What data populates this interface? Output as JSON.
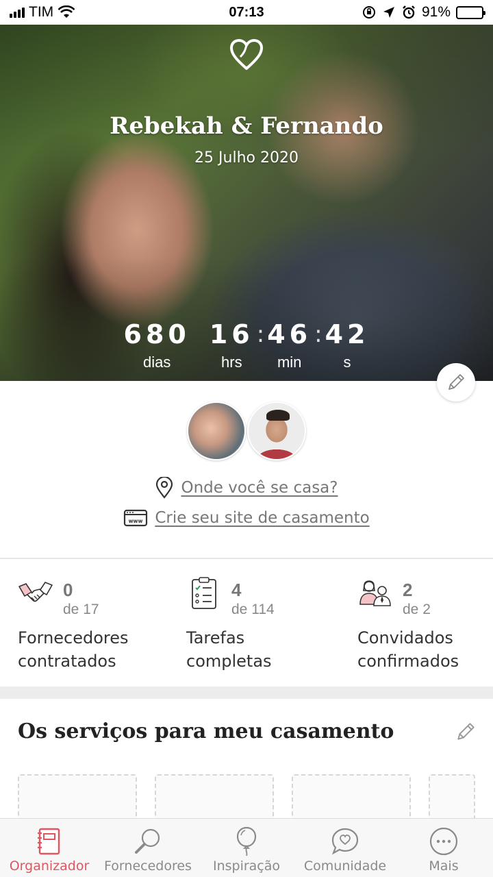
{
  "status_bar": {
    "carrier": "TIM",
    "time": "07:13",
    "battery_percent": "91%",
    "battery_level": 0.91
  },
  "hero": {
    "couple_names": "Rebekah & Fernando",
    "wedding_date": "25 Julho 2020",
    "countdown": {
      "days": "680",
      "days_label": "dias",
      "hours": "16",
      "hours_label": "hrs",
      "minutes": "46",
      "minutes_label": "min",
      "seconds": "42",
      "seconds_label": "s",
      "separator": ":"
    }
  },
  "profile": {
    "location_link": "Onde você se casa?",
    "website_link": "Crie seu site de casamento"
  },
  "stats": [
    {
      "count": "0",
      "total": "de 17",
      "label_line1": "Fornecedores",
      "label_line2": "contratados",
      "icon": "handshake-icon"
    },
    {
      "count": "4",
      "total": "de 114",
      "label_line1": "Tarefas",
      "label_line2": "completas",
      "icon": "checklist-icon"
    },
    {
      "count": "2",
      "total": "de 2",
      "label_line1": "Convidados",
      "label_line2": "confirmados",
      "icon": "guests-icon"
    }
  ],
  "services": {
    "title": "Os serviços para meu casamento"
  },
  "bottom_nav": {
    "items": [
      {
        "label": "Organizador",
        "icon": "planner-icon",
        "active": true
      },
      {
        "label": "Fornecedores",
        "icon": "search-icon",
        "active": false
      },
      {
        "label": "Inspiração",
        "icon": "balloon-icon",
        "active": false
      },
      {
        "label": "Comunidade",
        "icon": "chat-heart-icon",
        "active": false
      },
      {
        "label": "Mais",
        "icon": "more-icon",
        "active": false
      }
    ]
  },
  "colors": {
    "accent": "#e0555f",
    "text_muted": "#777777",
    "divider": "#e6e6e6"
  }
}
